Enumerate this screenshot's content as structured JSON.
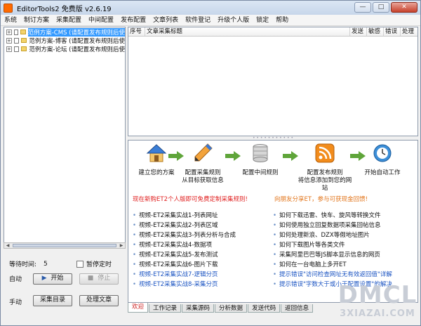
{
  "window": {
    "title": "EditorTools2 免费版 v2.6.19"
  },
  "menu": [
    "系统",
    "制订方案",
    "采集配置",
    "中间配置",
    "发布配置",
    "文章列表",
    "软件登记",
    "升级个人版",
    "锁定",
    "帮助"
  ],
  "tree": [
    {
      "label": "范例方案-CMS (请配置发布规则后使",
      "selected": true
    },
    {
      "label": "范例方案-博客 (请配置发布规则后使",
      "selected": false
    },
    {
      "label": "范例方案-论坛 (请配置发布规则后使",
      "selected": false
    }
  ],
  "controls": {
    "wait_label": "等待时间:",
    "wait_value": "5",
    "pause_label": "暂停定时",
    "auto_label": "自动",
    "start_label": "开始",
    "stop_label": "停止",
    "manual_label": "手动",
    "collect_label": "采集目录",
    "process_label": "处理文章"
  },
  "table": {
    "columns": [
      "序号",
      "文章采集标题",
      "发送",
      "敏感",
      "错误",
      "处理"
    ]
  },
  "steps": [
    {
      "icon": "house-icon",
      "label": "建立您的方案"
    },
    {
      "icon": "pencil-icon",
      "label": "配置采集规则\n从目标获取信息"
    },
    {
      "icon": "database-icon",
      "label": "配置中间规则"
    },
    {
      "icon": "rss-icon",
      "label": "配置发布规则\n将信息添加到您的网站"
    },
    {
      "icon": "clock-icon",
      "label": "开始自动工作"
    }
  ],
  "promo": {
    "left": "现在新购ET2个人版即可免费定制采集规则!",
    "right": "向朋友分享ET，参与可获现金回馈!"
  },
  "links_left": [
    {
      "text": "视频-ET2采集实战1-列表网址",
      "blue": false
    },
    {
      "text": "视频-ET2采集实战2-列表区域",
      "blue": false
    },
    {
      "text": "视频-ET2采集实战3-列表分析与合成",
      "blue": false
    },
    {
      "text": "视频-ET2采集实战4-数据项",
      "blue": false
    },
    {
      "text": "视频-ET2采集实战5-发布测试",
      "blue": false
    },
    {
      "text": "视频-ET2采集实战6-图片下载",
      "blue": false
    },
    {
      "text": "视频-ET2采集实战7-逻辑分页",
      "blue": true
    },
    {
      "text": "视频-ET2采集实战8-采集分页",
      "blue": true
    }
  ],
  "links_right": [
    {
      "text": "如何下载迅雷、快车、旋风等转换文件",
      "blue": false
    },
    {
      "text": "如何使用独立回复数据项采集回帖信息",
      "blue": false
    },
    {
      "text": "如何处理新浪、DZX等假地址图片",
      "blue": false
    },
    {
      "text": "如何下载图片等各类文件",
      "blue": false
    },
    {
      "text": "采集阿里巴巴等JS脚本显示信息的网页",
      "blue": false
    },
    {
      "text": "如何在一台电脑上多开ET",
      "blue": false
    },
    {
      "text": "提示错误\"访问检查网址无有效返回值\"详解",
      "blue": true
    },
    {
      "text": "提示错误\"字数大于或小于配置设置\"的解决",
      "blue": true
    }
  ],
  "tabs": [
    "欢迎",
    "工作记录",
    "采集源码",
    "分析数据",
    "发送代码",
    "返回信息"
  ],
  "watermark": {
    "main": "DMCL",
    "sub": "3XIAZAI.COM"
  }
}
